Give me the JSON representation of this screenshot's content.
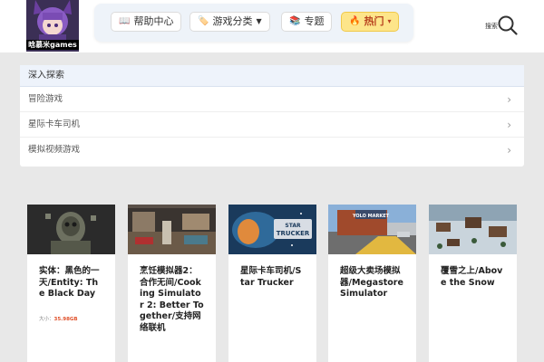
{
  "logo": {
    "text": "晗慕米games"
  },
  "nav": {
    "items": [
      {
        "icon": "📖",
        "label": "帮助中心"
      },
      {
        "icon": "🏷️",
        "label": "游戏分类",
        "caret": "▼"
      },
      {
        "icon": "📚",
        "label": "专题"
      },
      {
        "icon": "🔥",
        "label": "热门",
        "caret": "▾"
      }
    ]
  },
  "search": {
    "label": "搜索"
  },
  "explore": {
    "title": "深入探索",
    "items": [
      "冒险游戏",
      "星际卡车司机",
      "模拟视频游戏"
    ]
  },
  "cards": [
    {
      "title": "实体：黑色的一天/Entity: The Black Day",
      "size_label": "大小：",
      "size_value": "35.98GB"
    },
    {
      "title": "烹饪模拟器2：合作无间/Cooking Simulator 2: Better Together/支持网络联机"
    },
    {
      "title": "星际卡车司机/Star Trucker",
      "thumb_text": "STAR TRUCKER"
    },
    {
      "title": "超级大卖场模拟器/Megastore Simulator",
      "thumb_text": "YOLO MARKET"
    },
    {
      "title": "覆雪之上/Above the Snow"
    }
  ],
  "colors": {
    "hot_bg": "#fde58a",
    "hot_text": "#b8421f",
    "size_value": "#e0502a",
    "explore_head_bg": "#eef3fb"
  }
}
